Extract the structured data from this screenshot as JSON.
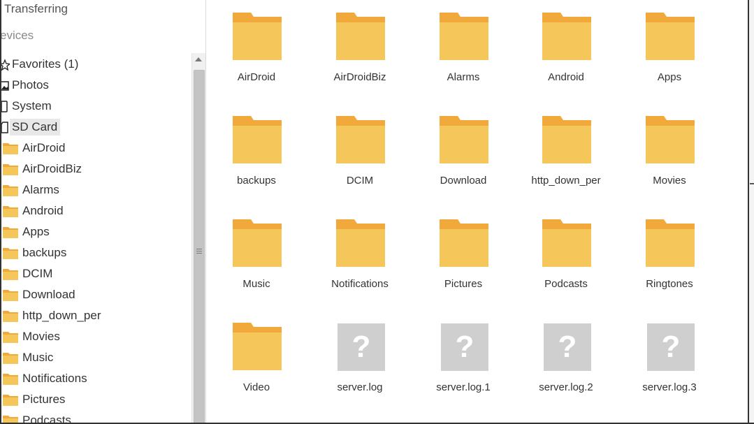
{
  "sidebar": {
    "transferring_label": "Transferring",
    "devices_label": "evices",
    "items": [
      {
        "label": "Favorites (1)",
        "icon": "star-icon"
      },
      {
        "label": "Photos",
        "icon": "image-icon"
      },
      {
        "label": "System",
        "icon": "phone-icon"
      },
      {
        "label": "SD Card",
        "icon": "sd-card-icon",
        "selected": true
      }
    ],
    "folders": [
      "AirDroid",
      "AirDroidBiz",
      "Alarms",
      "Android",
      "Apps",
      "backups",
      "DCIM",
      "Download",
      "http_down_per",
      "Movies",
      "Music",
      "Notifications",
      "Pictures",
      "Podcasts"
    ]
  },
  "main": {
    "items": [
      {
        "label": "AirDroid",
        "type": "folder"
      },
      {
        "label": "AirDroidBiz",
        "type": "folder"
      },
      {
        "label": "Alarms",
        "type": "folder"
      },
      {
        "label": "Android",
        "type": "folder"
      },
      {
        "label": "Apps",
        "type": "folder"
      },
      {
        "label": "backups",
        "type": "folder"
      },
      {
        "label": "DCIM",
        "type": "folder"
      },
      {
        "label": "Download",
        "type": "folder"
      },
      {
        "label": "http_down_per",
        "type": "folder"
      },
      {
        "label": "Movies",
        "type": "folder"
      },
      {
        "label": "Music",
        "type": "folder"
      },
      {
        "label": "Notifications",
        "type": "folder"
      },
      {
        "label": "Pictures",
        "type": "folder"
      },
      {
        "label": "Podcasts",
        "type": "folder"
      },
      {
        "label": "Ringtones",
        "type": "folder"
      },
      {
        "label": "Video",
        "type": "folder"
      },
      {
        "label": "server.log",
        "type": "unknown",
        "glyph": "?"
      },
      {
        "label": "server.log.1",
        "type": "unknown",
        "glyph": "?"
      },
      {
        "label": "server.log.2",
        "type": "unknown",
        "glyph": "?"
      },
      {
        "label": "server.log.3",
        "type": "unknown",
        "glyph": "?"
      }
    ]
  },
  "colors": {
    "folder_back": "#f2a93b",
    "folder_front": "#f5c75a",
    "unknown_bg": "#cfcfcf",
    "selected_bg": "#e8e8e8"
  }
}
